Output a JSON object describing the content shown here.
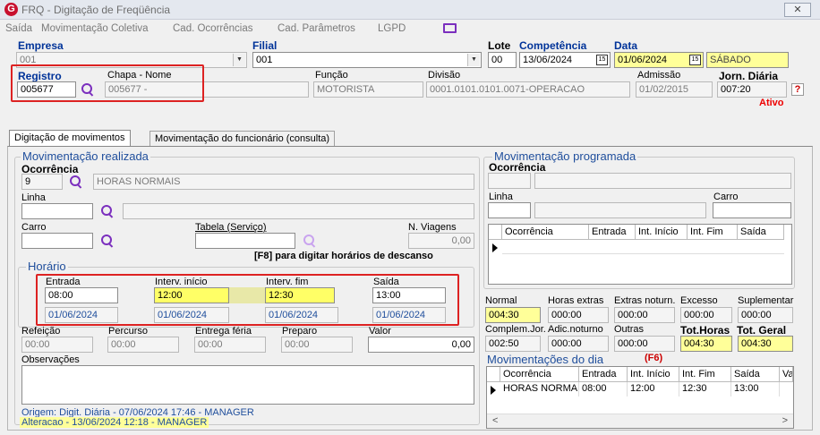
{
  "window": {
    "title": "FRQ - Digitação de Freqüência",
    "logo": "G",
    "close": "✕"
  },
  "menu": [
    "Saída",
    "Movimentação Coletiva",
    "Cad. Ocorrências",
    "Cad. Parâmetros",
    "LGPD"
  ],
  "header": {
    "empresa_label": "Empresa",
    "empresa_value": "001",
    "filial_label": "Filial",
    "filial_value": "001",
    "lote_label": "Lote",
    "lote_value": "00",
    "competencia_label": "Competência",
    "competencia_value": "13/06/2024",
    "data_label": "Data",
    "data_value": "01/06/2024",
    "weekday": "SÁBADO",
    "registro_label": "Registro",
    "registro_value": "005677",
    "chapa_label": "Chapa  -  Nome",
    "chapa_value": "005677 - ",
    "funcao_label": "Função",
    "funcao_value": "MOTORISTA",
    "divisao_label": "Divisão",
    "divisao_value": "0001.0101.0101.0071-OPERACAO",
    "admissao_label": "Admissão",
    "admissao_value": "01/02/2015",
    "jornada_label": "Jorn. Diária",
    "jornada_value": "007:20",
    "help": "?",
    "status": "Ativo"
  },
  "tabs": [
    "Digitação de movimentos",
    "Movimentação do funcionário (consulta)"
  ],
  "realizada": {
    "title": "Movimentação realizada",
    "ocorrencia_label": "Ocorrência",
    "ocorrencia_code": "9",
    "ocorrencia_desc": "HORAS NORMAIS",
    "linha_label": "Linha",
    "carro_label": "Carro",
    "tabela_label": "Tabela (Serviço)",
    "viagens_label": "N. Viagens",
    "viagens_value": "0,00",
    "f8_hint": "[F8] para digitar horários de descanso",
    "horario_title": "Horário",
    "entrada_label": "Entrada",
    "entrada_time": "08:00",
    "entrada_date": "01/06/2024",
    "int_inicio_label": "Interv. início",
    "int_inicio_time": "12:00",
    "int_inicio_date": "01/06/2024",
    "int_fim_label": "Interv. fim",
    "int_fim_time": "12:30",
    "int_fim_date": "01/06/2024",
    "saida_label": "Saída",
    "saida_time": "13:00",
    "saida_date": "01/06/2024",
    "refeicao_label": "Refeição",
    "refeicao_value": "00:00",
    "percurso_label": "Percurso",
    "percurso_value": "00:00",
    "entrega_label": "Entrega féria",
    "entrega_value": "00:00",
    "preparo_label": "Preparo",
    "preparo_value": "00:00",
    "valor_label": "Valor",
    "valor_value": "0,00",
    "obs_label": "Observações",
    "origem": "Origem: Digit. Diária - 07/06/2024 17:46 - MANAGER",
    "alteracao": "Alteracao - 13/06/2024 12:18 - MANAGER"
  },
  "programada": {
    "title": "Movimentação programada",
    "ocorrencia_label": "Ocorrência",
    "linha_label": "Linha",
    "carro_label": "Carro",
    "columns": [
      "Ocorrência",
      "Entrada",
      "Int. Início",
      "Int. Fim",
      "Saída"
    ]
  },
  "totals": {
    "normal_label": "Normal",
    "normal_value": "004:30",
    "extras_label": "Horas extras",
    "extras_value": "000:00",
    "extras_not_label": "Extras noturn.",
    "extras_not_value": "000:00",
    "excesso_label": "Excesso",
    "excesso_value": "000:00",
    "suplementar_label": "Suplementar",
    "suplementar_value": "000:00",
    "complem_label": "Complem.Jor.",
    "complem_value": "002:50",
    "adic_label": "Adic.noturno",
    "adic_value": "000:00",
    "outras_label": "Outras",
    "outras_value": "000:00",
    "tothoras_label": "Tot.Horas",
    "tothoras_value": "004:30",
    "totgeral_label": "Tot. Geral",
    "totgeral_value": "004:30"
  },
  "dia": {
    "title": "Movimentações do dia",
    "key": "(F6)",
    "columns": [
      "Ocorrência",
      "Entrada",
      "Int. Início",
      "Int. Fim",
      "Saída",
      "Va"
    ],
    "rows": [
      [
        "HORAS NORMAIS",
        "08:00",
        "12:00",
        "12:30",
        "13:00",
        ""
      ]
    ]
  }
}
